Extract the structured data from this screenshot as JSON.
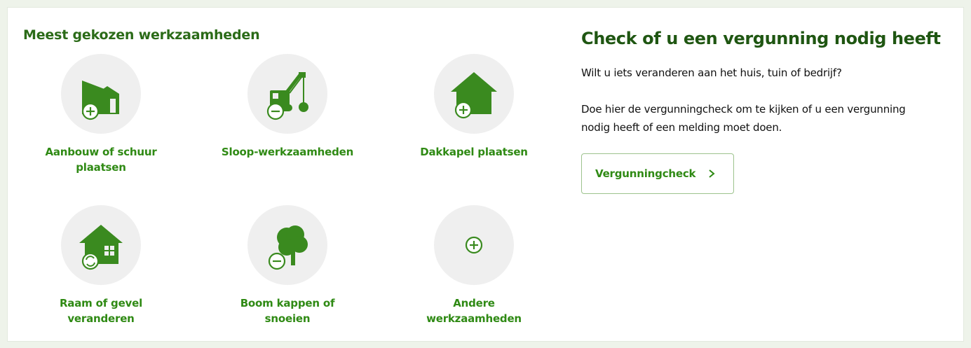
{
  "colors": {
    "accent_green": "#2f8a14",
    "heading_dark_green": "#1f5612",
    "icon_green": "#3a8a1f",
    "icon_circle_bg": "#efefef",
    "button_border": "#9dc38d"
  },
  "popular": {
    "heading": "Meest gekozen werkzaamheden",
    "items": [
      {
        "label": "Aanbouw of schuur plaatsen",
        "icon": "extension-shed-add-icon"
      },
      {
        "label": "Sloop-werkzaamheden",
        "icon": "demolition-crane-icon"
      },
      {
        "label": "Dakkapel plaatsen",
        "icon": "dormer-house-add-icon"
      },
      {
        "label": "Raam of gevel veranderen",
        "icon": "house-window-change-icon"
      },
      {
        "label": "Boom kappen of snoeien",
        "icon": "tree-remove-icon"
      },
      {
        "label": "Andere werkzaamheden",
        "icon": "plus-circle-icon"
      }
    ]
  },
  "check": {
    "heading": "Check of u een vergunning nodig heeft",
    "intro": "Wilt u iets veranderen aan het huis, tuin of bedrijf?",
    "body": "Doe hier de vergunningcheck om te kijken of u een vergunning nodig heeft of een melding moet doen.",
    "button_label": "Vergunningcheck",
    "button_icon": "chevron-right-icon"
  }
}
